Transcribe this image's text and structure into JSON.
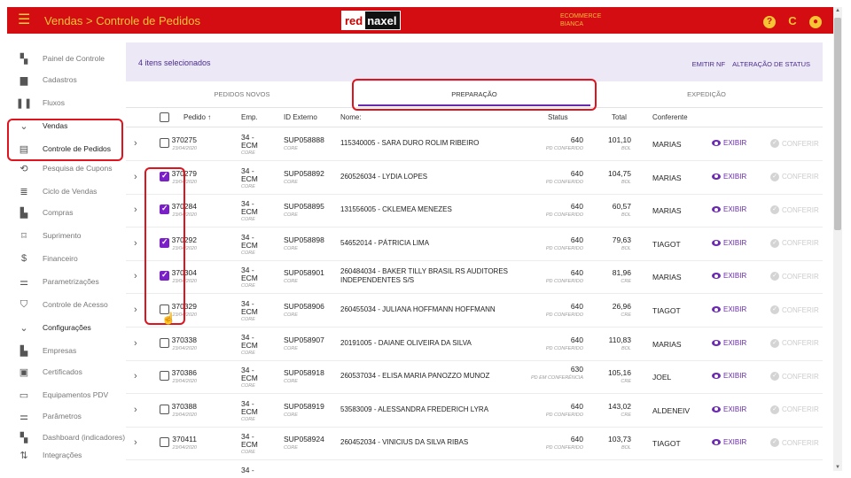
{
  "header": {
    "title": "Vendas > Controle de Pedidos",
    "logo_part1": "red",
    "logo_part2": "naxel",
    "env_line1": "ECOMMERCE",
    "env_line2": "BIANCA",
    "icons": [
      "menu-icon",
      "help-icon",
      "refresh-icon",
      "account-icon"
    ]
  },
  "sidebar": {
    "items": [
      {
        "label": "Painel de Controle",
        "icon": "dashboard-icon"
      },
      {
        "label": "Cadastros",
        "icon": "folder-icon"
      },
      {
        "label": "Fluxos",
        "icon": "columns-icon"
      },
      {
        "label": "Vendas",
        "icon": "chevron-down-icon"
      },
      {
        "label": "Controle de Pedidos",
        "icon": "orders-icon"
      },
      {
        "label": "Pesquisa de Cupons",
        "icon": "search-coupon-icon"
      },
      {
        "label": "Ciclo de Vendas",
        "icon": "list-icon"
      },
      {
        "label": "Compras",
        "icon": "building-icon"
      },
      {
        "label": "Suprimento",
        "icon": "supply-icon"
      },
      {
        "label": "Financeiro",
        "icon": "money-icon"
      },
      {
        "label": "Parametrizações",
        "icon": "sliders-icon"
      },
      {
        "label": "Controle de Acesso",
        "icon": "shield-icon"
      },
      {
        "label": "Configurações",
        "icon": "chevron-down-icon"
      },
      {
        "label": "Empresas",
        "icon": "building-icon"
      },
      {
        "label": "Certificados",
        "icon": "certificate-icon"
      },
      {
        "label": "Equipamentos PDV",
        "icon": "monitor-icon"
      },
      {
        "label": "Parâmetros",
        "icon": "sliders-icon"
      },
      {
        "label": "Dashboard (indicadores)",
        "icon": "dashboard-icon"
      },
      {
        "label": "Integrações",
        "icon": "integration-icon"
      }
    ]
  },
  "selection": {
    "text": "4 itens selecionados",
    "emitir_nf": "EMITIR NF",
    "alteracao_status": "ALTERAÇÃO DE STATUS"
  },
  "tabs": [
    {
      "label": "PEDIDOS NOVOS"
    },
    {
      "label": "PREPARAÇÃO"
    },
    {
      "label": "EXPEDIÇÃO"
    }
  ],
  "table": {
    "headers": {
      "pedido": "Pedido ↑",
      "emp": "Emp.",
      "id_externo": "ID Externo",
      "nome": "Nome:",
      "status": "Status",
      "total": "Total",
      "conferente": "Conferente"
    },
    "action_exibir": "EXIBIR",
    "action_conferir": "CONFERIR",
    "rows": [
      {
        "checked": false,
        "pedido": "370275",
        "date": "23/04/2020",
        "emp1": "34 -",
        "emp2": "ECM",
        "emp3": "CORE",
        "ext": "SUP058888",
        "ext2": "CORE",
        "nome": "115340005 - SARA DURO ROLIM RIBEIRO",
        "status": "640",
        "status2": "PD CONFERIDO",
        "total": "101,10",
        "total2": "BOL",
        "conferente": "MARIAS"
      },
      {
        "checked": true,
        "pedido": "370279",
        "date": "23/04/2020",
        "emp1": "34 -",
        "emp2": "ECM",
        "emp3": "CORE",
        "ext": "SUP058892",
        "ext2": "CORE",
        "nome": "260526034 - LYDIA LOPES",
        "status": "640",
        "status2": "PD CONFERIDO",
        "total": "104,75",
        "total2": "BOL",
        "conferente": "MARIAS"
      },
      {
        "checked": true,
        "pedido": "370284",
        "date": "23/04/2020",
        "emp1": "34 -",
        "emp2": "ECM",
        "emp3": "CORE",
        "ext": "SUP058895",
        "ext2": "CORE",
        "nome": "131556005 - CKLEMEA MENEZES",
        "status": "640",
        "status2": "PD CONFERIDO",
        "total": "60,57",
        "total2": "BOL",
        "conferente": "MARIAS"
      },
      {
        "checked": true,
        "pedido": "370292",
        "date": "23/04/2020",
        "emp1": "34 -",
        "emp2": "ECM",
        "emp3": "CORE",
        "ext": "SUP058898",
        "ext2": "CORE",
        "nome": "54652014 - PÁTRICIA LIMA",
        "status": "640",
        "status2": "PD CONFERIDO",
        "total": "79,63",
        "total2": "BOL",
        "conferente": "TIAGOT"
      },
      {
        "checked": true,
        "pedido": "370304",
        "date": "23/04/2020",
        "emp1": "34 -",
        "emp2": "ECM",
        "emp3": "CORE",
        "ext": "SUP058901",
        "ext2": "CORE",
        "nome": "260484034 - BAKER TILLY BRASIL RS AUDITORES INDEPENDENTES S/S",
        "status": "640",
        "status2": "PD CONFERIDO",
        "total": "81,96",
        "total2": "CRE",
        "conferente": "MARIAS"
      },
      {
        "checked": false,
        "pedido": "370329",
        "date": "23/04/2020",
        "emp1": "34 -",
        "emp2": "ECM",
        "emp3": "CORE",
        "ext": "SUP058906",
        "ext2": "CORE",
        "nome": "260455034 - JULIANA HOFFMANN HOFFMANN",
        "status": "640",
        "status2": "PD CONFERIDO",
        "total": "26,96",
        "total2": "CRE",
        "conferente": "TIAGOT"
      },
      {
        "checked": false,
        "pedido": "370338",
        "date": "23/04/2020",
        "emp1": "34 -",
        "emp2": "ECM",
        "emp3": "CORE",
        "ext": "SUP058907",
        "ext2": "CORE",
        "nome": "20191005 - DAIANE OLIVEIRA DA SILVA",
        "status": "640",
        "status2": "PD CONFERIDO",
        "total": "110,83",
        "total2": "BOL",
        "conferente": "MARIAS"
      },
      {
        "checked": false,
        "pedido": "370386",
        "date": "23/04/2020",
        "emp1": "34 -",
        "emp2": "ECM",
        "emp3": "CORE",
        "ext": "SUP058918",
        "ext2": "CORE",
        "nome": "260537034 - ELISA MARIA PANOZZO MUNOZ",
        "status": "630",
        "status2": "PD EM CONFERÊNCIA",
        "total": "105,16",
        "total2": "CRE",
        "conferente": "JOEL"
      },
      {
        "checked": false,
        "pedido": "370388",
        "date": "23/04/2020",
        "emp1": "34 -",
        "emp2": "ECM",
        "emp3": "CORE",
        "ext": "SUP058919",
        "ext2": "CORE",
        "nome": "53583009 - ALESSANDRA FREDERICH LYRA",
        "status": "640",
        "status2": "PD CONFERIDO",
        "total": "143,02",
        "total2": "CRE",
        "conferente": "ALDENEIV"
      },
      {
        "checked": false,
        "pedido": "370411",
        "date": "23/04/2020",
        "emp1": "34 -",
        "emp2": "ECM",
        "emp3": "CORE",
        "ext": "SUP058924",
        "ext2": "CORE",
        "nome": "260452034 - VINICIUS DA SILVA RIBAS",
        "status": "640",
        "status2": "PD CONFERIDO",
        "total": "103,73",
        "total2": "BOL",
        "conferente": "TIAGOT"
      },
      {
        "partial": true,
        "emp1": "34 -"
      }
    ]
  },
  "colors": {
    "topbar": "#d40d12",
    "accent": "#6a2ab0",
    "title": "#f6c534",
    "highlight": "#e0141e"
  }
}
